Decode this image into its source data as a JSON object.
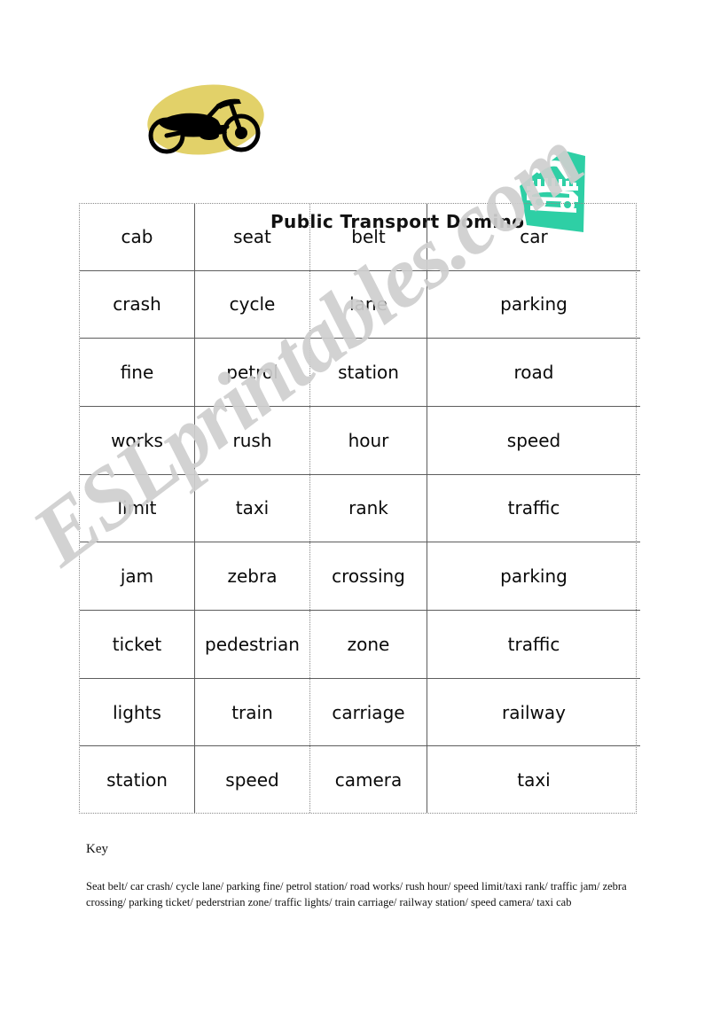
{
  "header": {
    "title": "Public Transport Domino",
    "motorcycle_icon": "motorcycle-icon",
    "taxi_icon": "taxi-icon",
    "colors": {
      "motorcycle_blob": "#e2d169",
      "motorcycle_body": "#000000",
      "taxi": "#2ecfa5"
    }
  },
  "watermark": {
    "text": "ESLprintables.com",
    "color": "#cfcfcf"
  },
  "grid": {
    "columns": 4,
    "rows": [
      [
        "cab",
        "seat",
        "belt",
        "car"
      ],
      [
        "crash",
        "cycle",
        "lane",
        "parking"
      ],
      [
        "fine",
        "petrol",
        "station",
        "road"
      ],
      [
        "works",
        "rush",
        "hour",
        "speed"
      ],
      [
        "limit",
        "taxi",
        "rank",
        "traffic"
      ],
      [
        "jam",
        "zebra",
        "crossing",
        "parking"
      ],
      [
        "ticket",
        "pedestrian",
        "zone",
        "traffic"
      ],
      [
        "lights",
        "train",
        "carriage",
        "railway"
      ],
      [
        "station",
        "speed",
        "camera",
        "taxi"
      ]
    ]
  },
  "key": {
    "title": "Key",
    "body": "Seat belt/ car crash/ cycle lane/ parking fine/ petrol station/ road works/ rush hour/ speed limit/taxi rank/ traffic jam/ zebra crossing/ parking ticket/ pederstrian zone/ traffic lights/ train carriage/ railway station/ speed camera/ taxi cab"
  }
}
